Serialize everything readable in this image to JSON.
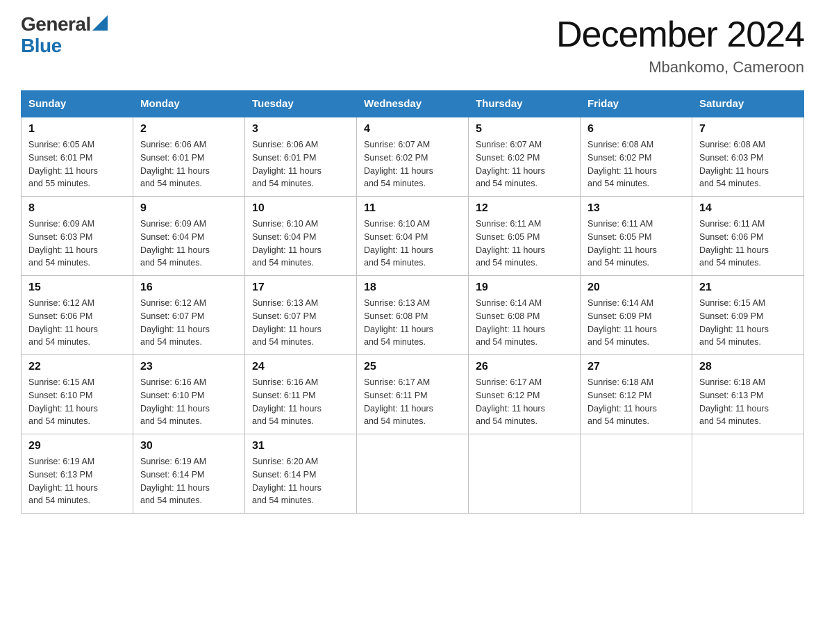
{
  "logo": {
    "general": "General",
    "blue": "Blue"
  },
  "title": {
    "month": "December 2024",
    "location": "Mbankomo, Cameroon"
  },
  "headers": [
    "Sunday",
    "Monday",
    "Tuesday",
    "Wednesday",
    "Thursday",
    "Friday",
    "Saturday"
  ],
  "weeks": [
    [
      {
        "day": "1",
        "sunrise": "6:05 AM",
        "sunset": "6:01 PM",
        "daylight": "11 hours and 55 minutes."
      },
      {
        "day": "2",
        "sunrise": "6:06 AM",
        "sunset": "6:01 PM",
        "daylight": "11 hours and 54 minutes."
      },
      {
        "day": "3",
        "sunrise": "6:06 AM",
        "sunset": "6:01 PM",
        "daylight": "11 hours and 54 minutes."
      },
      {
        "day": "4",
        "sunrise": "6:07 AM",
        "sunset": "6:02 PM",
        "daylight": "11 hours and 54 minutes."
      },
      {
        "day": "5",
        "sunrise": "6:07 AM",
        "sunset": "6:02 PM",
        "daylight": "11 hours and 54 minutes."
      },
      {
        "day": "6",
        "sunrise": "6:08 AM",
        "sunset": "6:02 PM",
        "daylight": "11 hours and 54 minutes."
      },
      {
        "day": "7",
        "sunrise": "6:08 AM",
        "sunset": "6:03 PM",
        "daylight": "11 hours and 54 minutes."
      }
    ],
    [
      {
        "day": "8",
        "sunrise": "6:09 AM",
        "sunset": "6:03 PM",
        "daylight": "11 hours and 54 minutes."
      },
      {
        "day": "9",
        "sunrise": "6:09 AM",
        "sunset": "6:04 PM",
        "daylight": "11 hours and 54 minutes."
      },
      {
        "day": "10",
        "sunrise": "6:10 AM",
        "sunset": "6:04 PM",
        "daylight": "11 hours and 54 minutes."
      },
      {
        "day": "11",
        "sunrise": "6:10 AM",
        "sunset": "6:04 PM",
        "daylight": "11 hours and 54 minutes."
      },
      {
        "day": "12",
        "sunrise": "6:11 AM",
        "sunset": "6:05 PM",
        "daylight": "11 hours and 54 minutes."
      },
      {
        "day": "13",
        "sunrise": "6:11 AM",
        "sunset": "6:05 PM",
        "daylight": "11 hours and 54 minutes."
      },
      {
        "day": "14",
        "sunrise": "6:11 AM",
        "sunset": "6:06 PM",
        "daylight": "11 hours and 54 minutes."
      }
    ],
    [
      {
        "day": "15",
        "sunrise": "6:12 AM",
        "sunset": "6:06 PM",
        "daylight": "11 hours and 54 minutes."
      },
      {
        "day": "16",
        "sunrise": "6:12 AM",
        "sunset": "6:07 PM",
        "daylight": "11 hours and 54 minutes."
      },
      {
        "day": "17",
        "sunrise": "6:13 AM",
        "sunset": "6:07 PM",
        "daylight": "11 hours and 54 minutes."
      },
      {
        "day": "18",
        "sunrise": "6:13 AM",
        "sunset": "6:08 PM",
        "daylight": "11 hours and 54 minutes."
      },
      {
        "day": "19",
        "sunrise": "6:14 AM",
        "sunset": "6:08 PM",
        "daylight": "11 hours and 54 minutes."
      },
      {
        "day": "20",
        "sunrise": "6:14 AM",
        "sunset": "6:09 PM",
        "daylight": "11 hours and 54 minutes."
      },
      {
        "day": "21",
        "sunrise": "6:15 AM",
        "sunset": "6:09 PM",
        "daylight": "11 hours and 54 minutes."
      }
    ],
    [
      {
        "day": "22",
        "sunrise": "6:15 AM",
        "sunset": "6:10 PM",
        "daylight": "11 hours and 54 minutes."
      },
      {
        "day": "23",
        "sunrise": "6:16 AM",
        "sunset": "6:10 PM",
        "daylight": "11 hours and 54 minutes."
      },
      {
        "day": "24",
        "sunrise": "6:16 AM",
        "sunset": "6:11 PM",
        "daylight": "11 hours and 54 minutes."
      },
      {
        "day": "25",
        "sunrise": "6:17 AM",
        "sunset": "6:11 PM",
        "daylight": "11 hours and 54 minutes."
      },
      {
        "day": "26",
        "sunrise": "6:17 AM",
        "sunset": "6:12 PM",
        "daylight": "11 hours and 54 minutes."
      },
      {
        "day": "27",
        "sunrise": "6:18 AM",
        "sunset": "6:12 PM",
        "daylight": "11 hours and 54 minutes."
      },
      {
        "day": "28",
        "sunrise": "6:18 AM",
        "sunset": "6:13 PM",
        "daylight": "11 hours and 54 minutes."
      }
    ],
    [
      {
        "day": "29",
        "sunrise": "6:19 AM",
        "sunset": "6:13 PM",
        "daylight": "11 hours and 54 minutes."
      },
      {
        "day": "30",
        "sunrise": "6:19 AM",
        "sunset": "6:14 PM",
        "daylight": "11 hours and 54 minutes."
      },
      {
        "day": "31",
        "sunrise": "6:20 AM",
        "sunset": "6:14 PM",
        "daylight": "11 hours and 54 minutes."
      },
      null,
      null,
      null,
      null
    ]
  ],
  "labels": {
    "sunrise": "Sunrise:",
    "sunset": "Sunset:",
    "daylight": "Daylight:"
  }
}
